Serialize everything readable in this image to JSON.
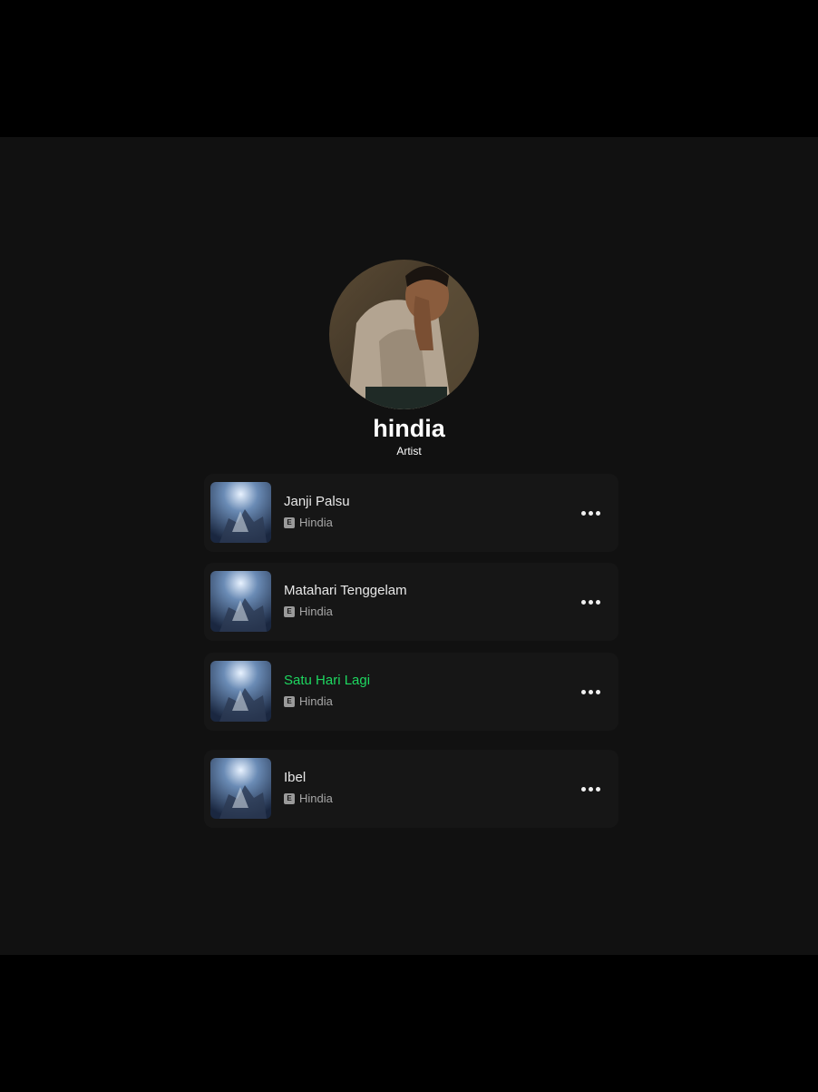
{
  "artist": {
    "name": "hindia",
    "role": "Artist"
  },
  "tracks": [
    {
      "title": "Janji Palsu",
      "explicit_label": "E",
      "artist": "Hindia",
      "playing": false,
      "more_icon": "more-horizontal-icon"
    },
    {
      "title": "Matahari Tenggelam",
      "explicit_label": "E",
      "artist": "Hindia",
      "playing": false,
      "more_icon": "more-horizontal-icon"
    },
    {
      "title": "Satu Hari Lagi",
      "explicit_label": "E",
      "artist": "Hindia",
      "playing": true,
      "more_icon": "more-horizontal-icon"
    },
    {
      "title": "Ibel",
      "explicit_label": "E",
      "artist": "Hindia",
      "playing": false,
      "more_icon": "more-horizontal-icon"
    }
  ],
  "colors": {
    "background": "#111111",
    "letterbox": "#000000",
    "card": "#161616",
    "playing_accent": "#1ed760",
    "text_primary": "#e8e8e8",
    "text_secondary": "#a7a7a7"
  }
}
